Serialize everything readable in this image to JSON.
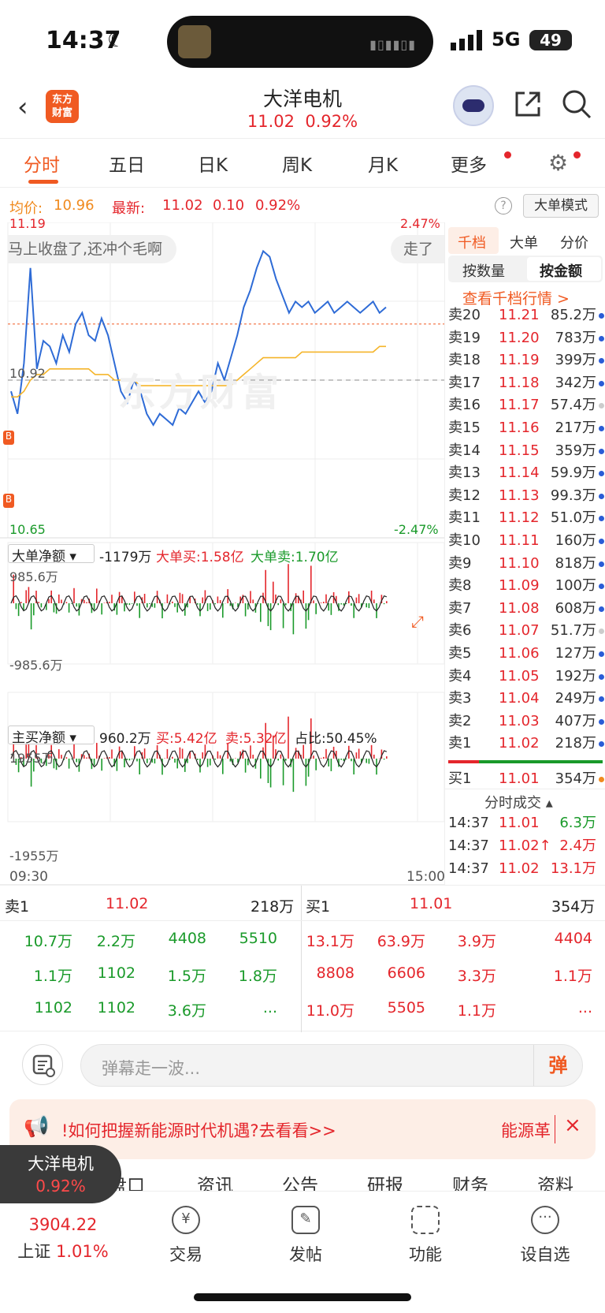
{
  "status": {
    "time": "14:37",
    "network": "5G",
    "battery": "49"
  },
  "header": {
    "logo_line1": "东方",
    "logo_line2": "财富",
    "stock_name": "大洋电机",
    "price": "11.02",
    "change_pct": "0.92%"
  },
  "tabs": [
    {
      "label": "分时"
    },
    {
      "label": "五日"
    },
    {
      "label": "日K"
    },
    {
      "label": "周K"
    },
    {
      "label": "月K"
    },
    {
      "label": "更多"
    }
  ],
  "info": {
    "avg_label": "均价:",
    "avg_value": "10.96",
    "latest_label": "最新:",
    "latest_value": "11.02",
    "change": "0.10",
    "change_pct": "0.92%",
    "mode_button": "大单模式"
  },
  "chart_data": {
    "type": "line",
    "title": "",
    "y_high": "11.19",
    "y_low": "10.65",
    "y_ref": "10.92",
    "pct_high": "2.47%",
    "pct_low": "-2.47%",
    "x_start": "09:30",
    "x_end": "15:00",
    "ylim": [
      10.65,
      11.19
    ],
    "series": [
      {
        "values": [
          10.9,
          10.86,
          10.95,
          11.12,
          10.94,
          10.99,
          10.98,
          10.95,
          11.0,
          10.97,
          11.02,
          11.04,
          11.0,
          10.99,
          11.03,
          11.0,
          10.95,
          10.9,
          10.88,
          10.92,
          10.9,
          10.86,
          10.84,
          10.86,
          10.85,
          10.84,
          10.87,
          10.86,
          10.88,
          10.9,
          10.88,
          10.9,
          10.95,
          10.92,
          10.96,
          11.0,
          11.05,
          11.08,
          11.12,
          11.15,
          11.14,
          11.1,
          11.07,
          11.04,
          11.06,
          11.05,
          11.06,
          11.04,
          11.05,
          11.06,
          11.04,
          11.05,
          11.06,
          11.05,
          11.04,
          11.05,
          11.06,
          11.04,
          11.05
        ]
      },
      {
        "values": [
          10.89,
          10.89,
          10.9,
          10.92,
          10.93,
          10.93,
          10.94,
          10.94,
          10.94,
          10.94,
          10.94,
          10.94,
          10.94,
          10.93,
          10.93,
          10.93,
          10.92,
          10.92,
          10.92,
          10.92,
          10.91,
          10.91,
          10.91,
          10.91,
          10.91,
          10.91,
          10.91,
          10.91,
          10.91,
          10.91,
          10.91,
          10.91,
          10.91,
          10.91,
          10.91,
          10.92,
          10.93,
          10.94,
          10.95,
          10.96,
          10.96,
          10.96,
          10.96,
          10.96,
          10.96,
          10.97,
          10.97,
          10.97,
          10.97,
          10.97,
          10.97,
          10.97,
          10.97,
          10.97,
          10.97,
          10.97,
          10.97,
          10.98,
          10.98
        ]
      }
    ]
  },
  "danmu_overlay": [
    "马上收盘了,还冲个毛啊",
    "走了"
  ],
  "watermark": "东方财富",
  "net_large": {
    "label": "大单净额",
    "value": "-1179万",
    "buy": "大单买:1.58亿",
    "sell": "大单卖:1.70亿",
    "top": "985.6万",
    "bottom": "-985.6万"
  },
  "net_main": {
    "label": "主买净额",
    "value": "960.2万",
    "buy": "买:5.42亿",
    "sell": "卖:5.32亿",
    "ratio": "占比:50.45%",
    "top": "1955万",
    "bottom": "-1955万"
  },
  "right": {
    "tabs": [
      "千档",
      "大单",
      "分价"
    ],
    "sub_tabs": [
      "按数量",
      "按金额"
    ],
    "view_more": "查看千档行情 >",
    "trades_title": "分时成交"
  },
  "order_book": [
    {
      "l": "卖20",
      "p": "11.21",
      "v": "85.2万"
    },
    {
      "l": "卖19",
      "p": "11.20",
      "v": "783万"
    },
    {
      "l": "卖18",
      "p": "11.19",
      "v": "399万"
    },
    {
      "l": "卖17",
      "p": "11.18",
      "v": "342万"
    },
    {
      "l": "卖16",
      "p": "11.17",
      "v": "57.4万"
    },
    {
      "l": "卖15",
      "p": "11.16",
      "v": "217万"
    },
    {
      "l": "卖14",
      "p": "11.15",
      "v": "359万"
    },
    {
      "l": "卖13",
      "p": "11.14",
      "v": "59.9万"
    },
    {
      "l": "卖12",
      "p": "11.13",
      "v": "99.3万"
    },
    {
      "l": "卖11",
      "p": "11.12",
      "v": "51.0万"
    },
    {
      "l": "卖10",
      "p": "11.11",
      "v": "160万"
    },
    {
      "l": "卖9",
      "p": "11.10",
      "v": "818万"
    },
    {
      "l": "卖8",
      "p": "11.09",
      "v": "100万"
    },
    {
      "l": "卖7",
      "p": "11.08",
      "v": "608万"
    },
    {
      "l": "卖6",
      "p": "11.07",
      "v": "51.7万"
    },
    {
      "l": "卖5",
      "p": "11.06",
      "v": "127万"
    },
    {
      "l": "卖4",
      "p": "11.05",
      "v": "192万"
    },
    {
      "l": "卖3",
      "p": "11.04",
      "v": "249万"
    },
    {
      "l": "卖2",
      "p": "11.03",
      "v": "407万"
    },
    {
      "l": "卖1",
      "p": "11.02",
      "v": "218万"
    }
  ],
  "buy1": {
    "l": "买1",
    "p": "11.01",
    "v": "354万"
  },
  "trades": [
    {
      "t": "14:37",
      "p": "11.01",
      "v": "6.3万"
    },
    {
      "t": "14:37",
      "p": "11.02↑",
      "v": "2.4万"
    },
    {
      "t": "14:37",
      "p": "11.02",
      "v": "13.1万"
    }
  ],
  "levels": {
    "sell_label": "卖1",
    "sell_price": "11.02",
    "sell_vol": "218万",
    "buy_label": "买1",
    "buy_price": "11.01",
    "buy_vol": "354万",
    "sell_rows": [
      [
        "10.7万",
        "2.2万",
        "4408",
        "5510"
      ],
      [
        "1.1万",
        "1102",
        "1.5万",
        "1.8万"
      ],
      [
        "1102",
        "1102",
        "3.6万",
        "..."
      ]
    ],
    "buy_rows": [
      [
        "13.1万",
        "63.9万",
        "3.9万",
        "4404"
      ],
      [
        "8808",
        "6606",
        "3.3万",
        "1.1万"
      ],
      [
        "11.0万",
        "5505",
        "1.1万",
        "..."
      ]
    ]
  },
  "danmu_input": {
    "placeholder": "弹幕走一波...",
    "button": "弹"
  },
  "banner": {
    "text": "!如何把握新能源时代机遇?去看看>>",
    "right": "能源革"
  },
  "sub_tabs": [
    "盘口",
    "资讯",
    "公告",
    "研报",
    "财务",
    "资料"
  ],
  "mini": {
    "name": "大洋电机",
    "pct": "0.92%"
  },
  "nav": {
    "index_value": "3904.22",
    "index_name": "上证",
    "index_pct": "1.01%",
    "items": [
      "交易",
      "发帖",
      "功能",
      "设自选"
    ]
  }
}
